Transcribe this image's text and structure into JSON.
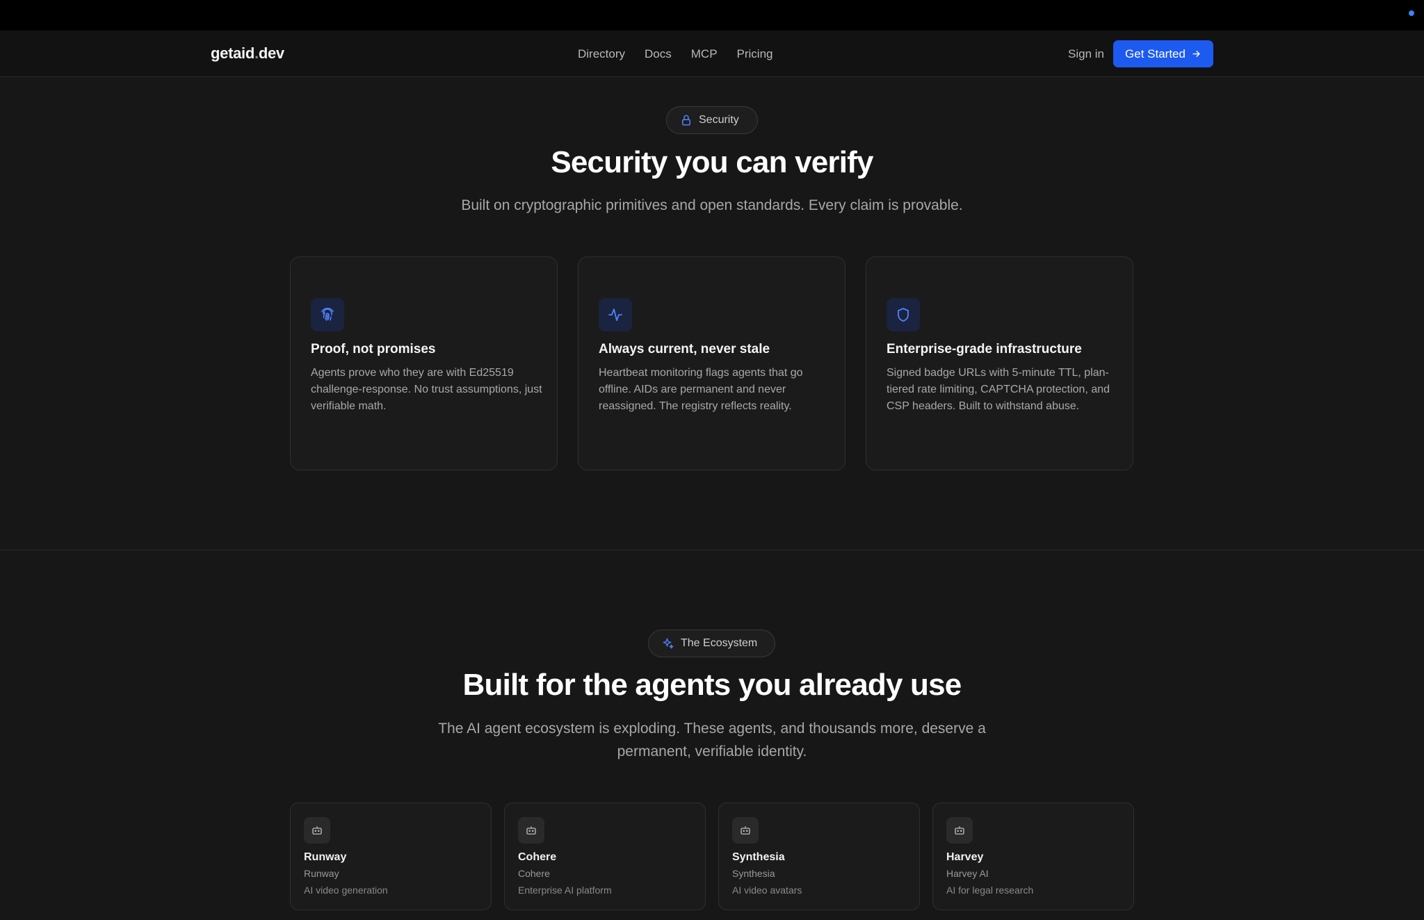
{
  "colors": {
    "accent": "#1d5af0",
    "icon_blue": "#4f83ff",
    "background": "#171717"
  },
  "header": {
    "logo_main": "getaid",
    "logo_dot": ".",
    "logo_tld": "dev",
    "nav": [
      "Directory",
      "Docs",
      "MCP",
      "Pricing"
    ],
    "sign_in": "Sign in",
    "get_started": "Get Started"
  },
  "security": {
    "badge": "Security",
    "badge_icon": "lock-icon",
    "title": "Security you can verify",
    "subtitle": "Built on cryptographic primitives and open standards. Every claim is provable.",
    "features": [
      {
        "icon": "fingerprint-icon",
        "title": "Proof, not promises",
        "description": "Agents prove who they are with Ed25519 challenge-response. No trust assumptions, just verifiable math."
      },
      {
        "icon": "activity-icon",
        "title": "Always current, never stale",
        "description": "Heartbeat monitoring flags agents that go offline. AIDs are permanent and never reassigned. The registry reflects reality."
      },
      {
        "icon": "shield-icon",
        "title": "Enterprise-grade infrastructure",
        "description": "Signed badge URLs with 5-minute TTL, plan-tiered rate limiting, CAPTCHA protection, and CSP headers. Built to withstand abuse."
      }
    ]
  },
  "ecosystem": {
    "badge": "The Ecosystem",
    "badge_icon": "sparkles-icon",
    "title": "Built for the agents you already use",
    "subtitle_line1": "The AI agent ecosystem is exploding. These agents, and thousands more, deserve a",
    "subtitle_line2": "permanent, verifiable identity.",
    "agents": [
      {
        "icon": "bot-icon",
        "name": "Runway",
        "org": "Runway",
        "description": "AI video generation"
      },
      {
        "icon": "bot-icon",
        "name": "Cohere",
        "org": "Cohere",
        "description": "Enterprise AI platform"
      },
      {
        "icon": "bot-icon",
        "name": "Synthesia",
        "org": "Synthesia",
        "description": "AI video avatars"
      },
      {
        "icon": "bot-icon",
        "name": "Harvey",
        "org": "Harvey AI",
        "description": "AI for legal research"
      }
    ]
  }
}
